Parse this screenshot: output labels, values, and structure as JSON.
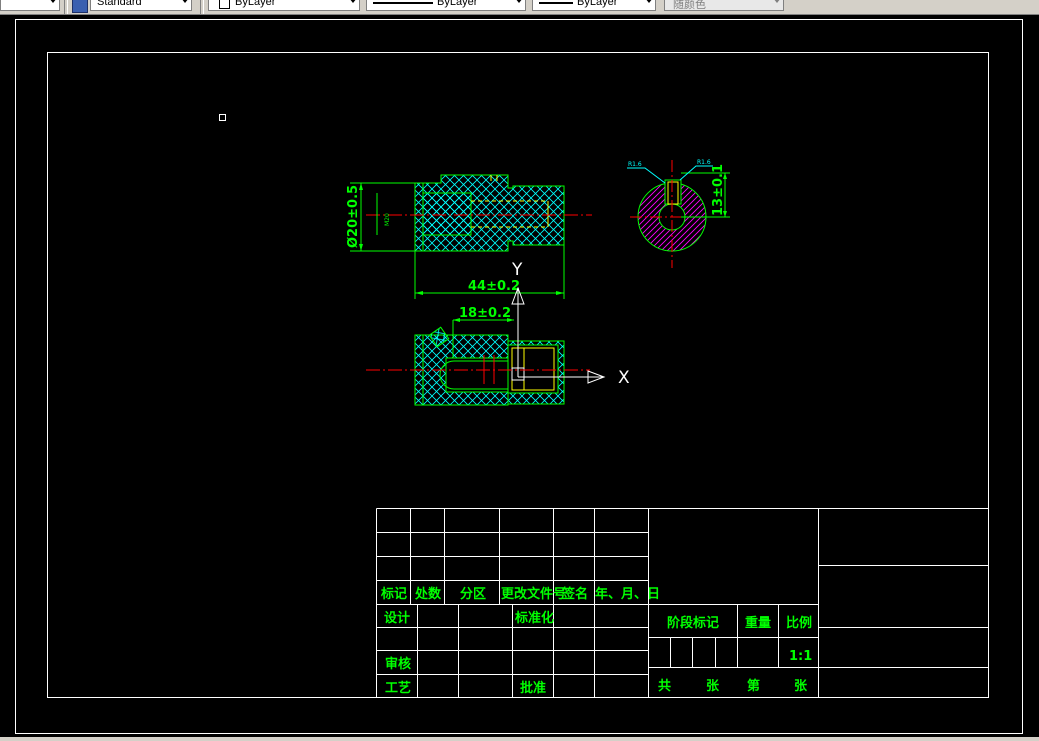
{
  "toolbar": {
    "first_combo_text": "",
    "style_combo": "Standard",
    "layer_combo": "ByLayer",
    "linetype_combo": "ByLayer",
    "lineweight_combo": "ByLayer",
    "color_combo": "随颜色"
  },
  "drawing": {
    "dim_diameter": "Ø20±0.5",
    "dim_small_left": "M20",
    "dim_length": "44±0.2",
    "dim_offset": "18±0.2",
    "dim_height": "13±0.1",
    "leader_left": "R1.6",
    "leader_right": "R1.6",
    "axis_y": "Y",
    "axis_x": "X"
  },
  "title_block": {
    "mark": "标记",
    "count": "处数",
    "zone": "分区",
    "change_doc": "更改文件号",
    "signature": "签名",
    "date": "年、月、日",
    "design": "设计",
    "standardize": "标准化",
    "review": "审核",
    "process": "工艺",
    "approve": "批准",
    "stage_mark": "阶段标记",
    "weight": "重量",
    "scale_label": "比例",
    "scale_value": "1:1",
    "total": "共",
    "sheets": "张",
    "sheet_no": "第",
    "sheets2": "张"
  },
  "colors": {
    "canvas": "#000000",
    "border": "#ffffff",
    "geometry": "#00ff00",
    "hatch": "#00ffff",
    "center_line": "#ff0000",
    "section_hatch": "#ff00ff",
    "detail": "#ffff00",
    "text": "#00ff00"
  }
}
